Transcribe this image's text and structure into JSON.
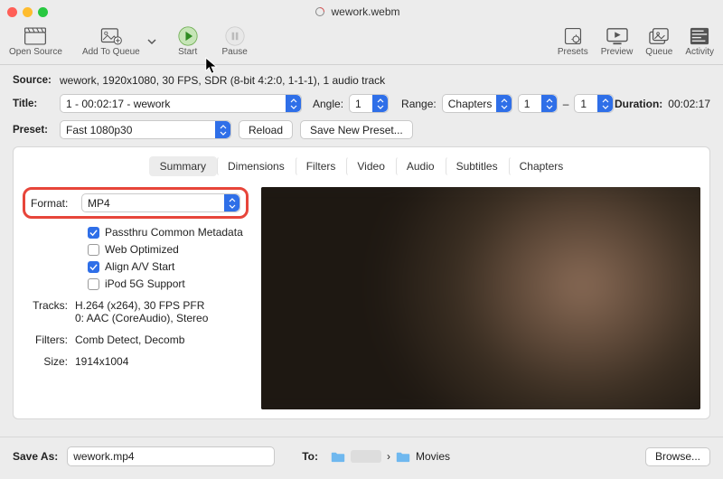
{
  "window": {
    "title": "wework.webm"
  },
  "toolbar": {
    "open_source": "Open Source",
    "add_to_queue": "Add To Queue",
    "start": "Start",
    "pause": "Pause",
    "presets": "Presets",
    "preview": "Preview",
    "queue": "Queue",
    "activity": "Activity"
  },
  "source": {
    "label": "Source:",
    "value": "wework, 1920x1080, 30 FPS, SDR (8-bit 4:2:0, 1-1-1), 1 audio track"
  },
  "title": {
    "label": "Title:",
    "value": "1 - 00:02:17 - wework",
    "angle_label": "Angle:",
    "angle_value": "1",
    "range_label": "Range:",
    "range_mode": "Chapters",
    "range_from": "1",
    "range_to": "1",
    "range_sep": "–",
    "duration_label": "Duration:",
    "duration_value": "00:02:17"
  },
  "preset": {
    "label": "Preset:",
    "value": "Fast 1080p30",
    "reload": "Reload",
    "save_new": "Save New Preset..."
  },
  "tabs": {
    "summary": "Summary",
    "dimensions": "Dimensions",
    "filters": "Filters",
    "video": "Video",
    "audio": "Audio",
    "subtitles": "Subtitles",
    "chapters": "Chapters"
  },
  "summary": {
    "format_label": "Format:",
    "format_value": "MP4",
    "passthru": "Passthru Common Metadata",
    "web_optimized": "Web Optimized",
    "align_av": "Align A/V Start",
    "ipod": "iPod 5G Support",
    "tracks_label": "Tracks:",
    "tracks_line1": "H.264 (x264), 30 FPS PFR",
    "tracks_line2": "0: AAC (CoreAudio), Stereo",
    "filters_label": "Filters:",
    "filters_value": "Comb Detect, Decomb",
    "size_label": "Size:",
    "size_value": "1914x1004"
  },
  "bottom": {
    "save_as_label": "Save As:",
    "save_as_value": "wework.mp4",
    "to_label": "To:",
    "crumb_sep": "›",
    "dest_folder": "Movies",
    "browse": "Browse..."
  }
}
